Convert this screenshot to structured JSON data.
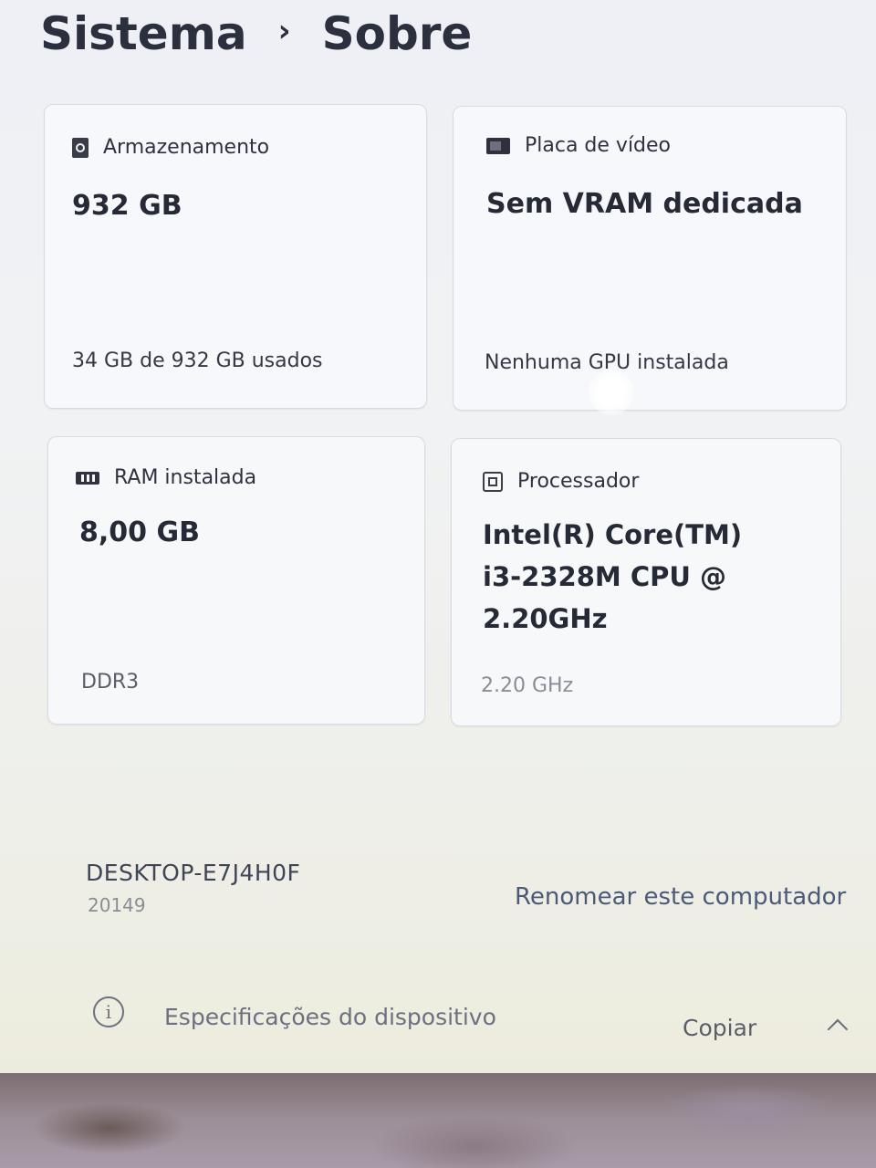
{
  "breadcrumb": {
    "parent": "Sistema",
    "separator": "›",
    "current": "Sobre"
  },
  "cards": {
    "storage": {
      "icon": "storage-icon",
      "title": "Armazenamento",
      "value": "932 GB",
      "detail": "34 GB de 932 GB usados"
    },
    "gpu": {
      "icon": "gpu-icon",
      "title": "Placa de vídeo",
      "value": "Sem VRAM dedicada",
      "detail": "Nenhuma GPU instalada"
    },
    "ram": {
      "icon": "ram-icon",
      "title": "RAM instalada",
      "value": "8,00 GB",
      "detail": "DDR3"
    },
    "cpu": {
      "icon": "cpu-icon",
      "title": "Processador",
      "value_lines": [
        "Intel(R) Core(TM)",
        "i3-2328M CPU @",
        "2.20GHz"
      ],
      "detail": "2.20 GHz"
    }
  },
  "device": {
    "name": "DESKTOP-E7J4H0F",
    "id": "20149",
    "rename_label": "Renomear este computador"
  },
  "specs": {
    "info_icon": "info-icon",
    "title": "Especificações do dispositivo",
    "copy_label": "Copiar",
    "collapse_icon": "chevron-up-icon"
  },
  "colors": {
    "link": "#4a5a78",
    "card_bg": "#f7f8fb",
    "title_text": "#2b2f3e"
  }
}
